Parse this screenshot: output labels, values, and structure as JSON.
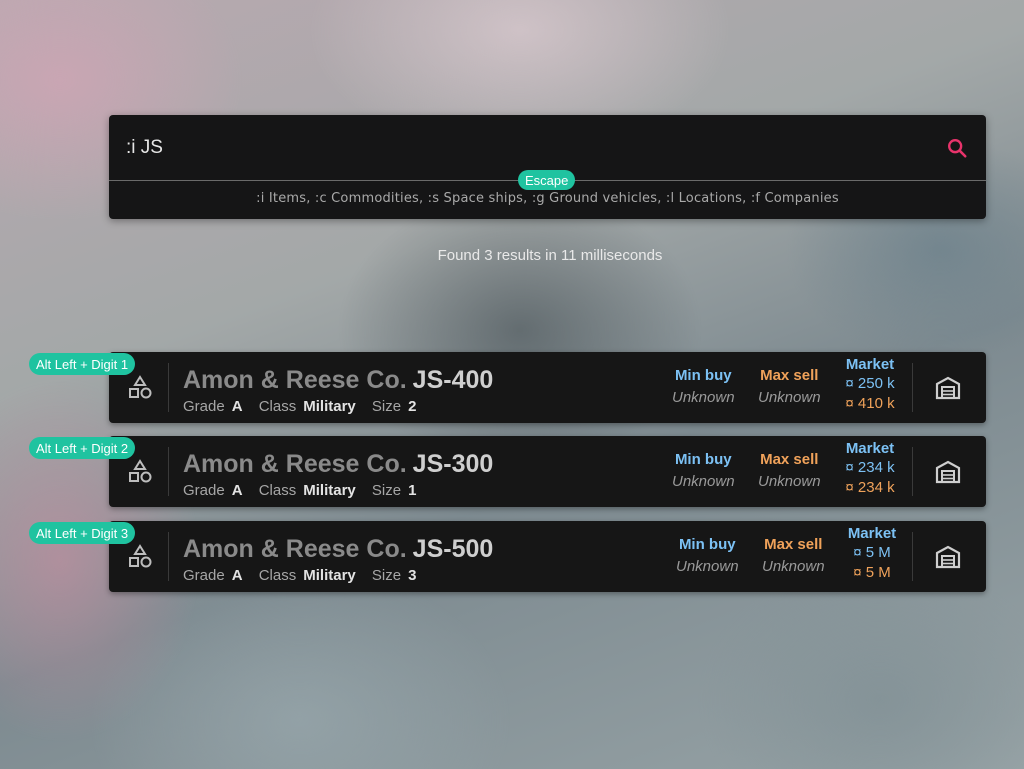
{
  "search": {
    "query": ":i JS",
    "escape_label": "Escape",
    "hint": ":i Items, :c Commodities, :s Space ships, :g Ground vehicles, :l Locations, :f Companies"
  },
  "results_summary": "Found 3 results in 11 milliseconds",
  "labels": {
    "grade": "Grade",
    "class": "Class",
    "size": "Size",
    "min_buy": "Min buy",
    "max_sell": "Max sell",
    "market": "Market",
    "currency_symbol": "¤"
  },
  "results": [
    {
      "shortcut": "Alt Left + Digit 1",
      "maker": "Amon & Reese Co.",
      "model": "JS-400",
      "grade": "A",
      "class": "Military",
      "size": "2",
      "min_buy": "Unknown",
      "max_sell": "Unknown",
      "market_buy": "¤ 250 k",
      "market_sell": "¤ 410 k"
    },
    {
      "shortcut": "Alt Left + Digit 2",
      "maker": "Amon & Reese Co.",
      "model": "JS-300",
      "grade": "A",
      "class": "Military",
      "size": "1",
      "min_buy": "Unknown",
      "max_sell": "Unknown",
      "market_buy": "¤ 234 k",
      "market_sell": "¤ 234 k"
    },
    {
      "shortcut": "Alt Left + Digit 3",
      "maker": "Amon & Reese Co.",
      "model": "JS-500",
      "grade": "A",
      "class": "Military",
      "size": "3",
      "min_buy": "Unknown",
      "max_sell": "Unknown",
      "market_buy": "¤ 5 M",
      "market_sell": "¤ 5 M"
    }
  ],
  "colors": {
    "accent": "#1fc3a0",
    "search_icon": "#e8336b",
    "buy": "#7cc1f4",
    "sell": "#f0a25a"
  },
  "icons": {
    "search": "search-icon",
    "item_type": "shapes-icon",
    "warehouse": "warehouse-icon"
  }
}
